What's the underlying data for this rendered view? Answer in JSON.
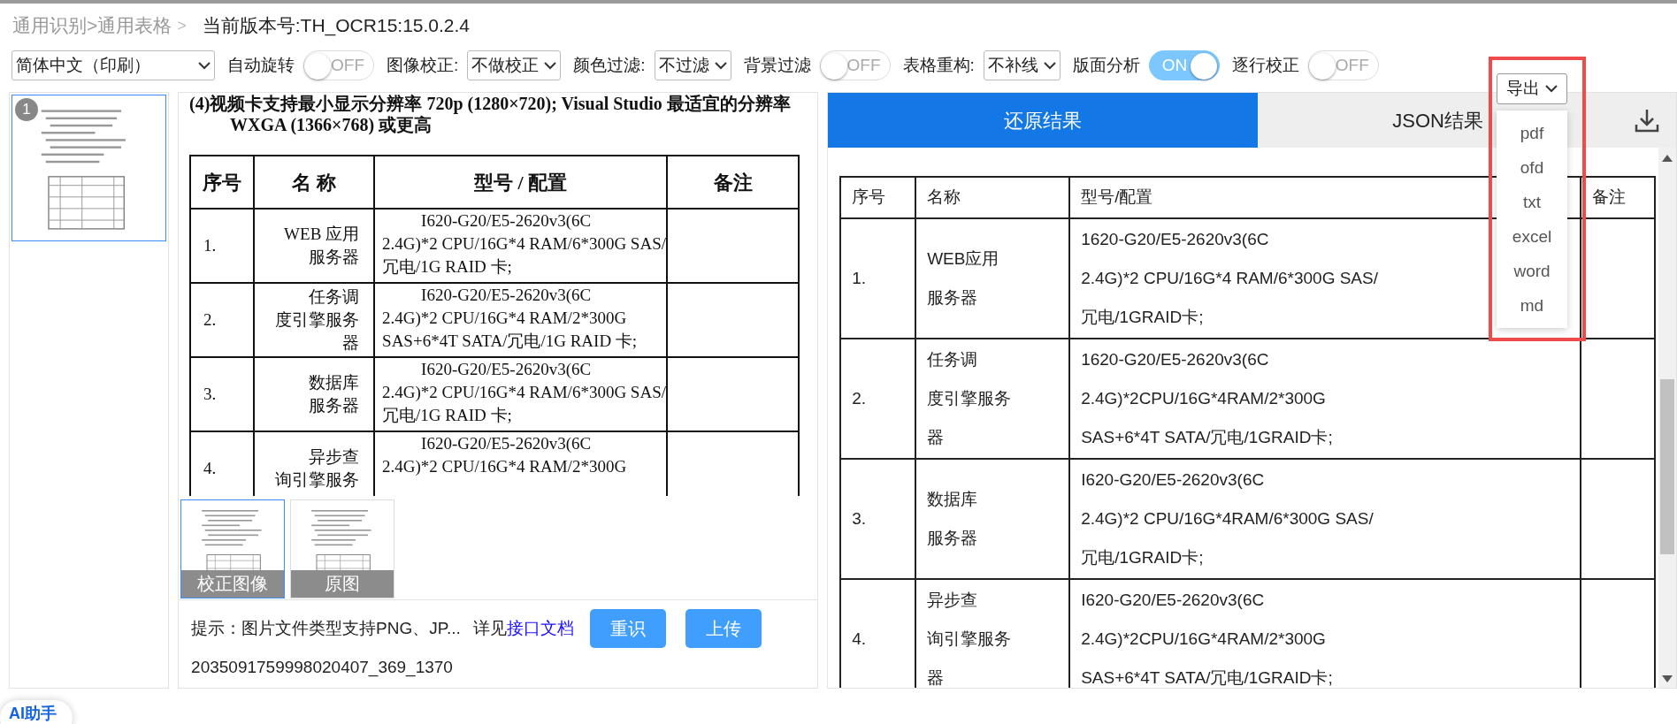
{
  "breadcrumb": {
    "path": "通用识别>通用表格",
    "separator": ">",
    "version": "当前版本号:TH_OCR15:15.0.2.4"
  },
  "toolbar": [
    {
      "kind": "select",
      "value": "简体中文（印刷）"
    },
    {
      "kind": "toggle",
      "label": "自动旋转",
      "on": false,
      "state_text": "OFF"
    },
    {
      "kind": "select",
      "label": "图像校正:",
      "value": "不做校正"
    },
    {
      "kind": "select",
      "label": "颜色过滤:",
      "value": "不过滤"
    },
    {
      "kind": "toggle",
      "label": "背景过滤",
      "on": false,
      "state_text": "OFF"
    },
    {
      "kind": "select",
      "label": "表格重构:",
      "value": "不补线"
    },
    {
      "kind": "toggle",
      "label": "版面分析",
      "on": true,
      "state_text": "ON"
    },
    {
      "kind": "toggle",
      "label": "逐行校正",
      "on": false,
      "state_text": "OFF"
    }
  ],
  "export": {
    "label": "导出",
    "expanded": true,
    "options": [
      "pdf",
      "ofd",
      "txt",
      "excel",
      "word",
      "md"
    ]
  },
  "pages": [
    {
      "number": "1",
      "selected": true
    }
  ],
  "document": {
    "intro": [
      "(4)视频卡支持最小显示分辨率 720p (1280×720); Visual Studio 最适宜的分辨率",
      "WXGA (1366×768) 或更高"
    ],
    "columns": [
      "序号",
      "名 称",
      "型号 / 配置",
      "备注"
    ],
    "rows": [
      {
        "no": "1.",
        "name": [
          "WEB 应用",
          "服务器"
        ],
        "config": [
          "I620-G20/E5-2620v3(6C",
          "2.4G)*2 CPU/16G*4 RAM/6*300G SAS/",
          "冗电/1G RAID 卡;"
        ]
      },
      {
        "no": "2.",
        "name": [
          "任务调",
          "度引擎服务",
          "器"
        ],
        "config": [
          "I620-G20/E5-2620v3(6C",
          "2.4G)*2 CPU/16G*4 RAM/2*300G",
          "SAS+6*4T SATA/冗电/1G RAID 卡;"
        ]
      },
      {
        "no": "3.",
        "name": [
          "数据库",
          "服务器"
        ],
        "config": [
          "I620-G20/E5-2620v3(6C",
          "2.4G)*2 CPU/16G*4 RAM/6*300G SAS/",
          "冗电/1G RAID 卡;"
        ]
      },
      {
        "no": "4.",
        "name": [
          "异步查",
          "询引擎服务"
        ],
        "config": [
          "I620-G20/E5-2620v3(6C",
          "2.4G)*2 CPU/16G*4 RAM/2*300G"
        ]
      }
    ]
  },
  "image_versions": [
    {
      "label": "校正图像",
      "selected": true
    },
    {
      "label": "原图",
      "selected": false
    }
  ],
  "hint": {
    "text": "提示：图片文件类型支持PNG、JP...",
    "see": "详见",
    "link": "接口文档"
  },
  "buttons": [
    "重识",
    "上传"
  ],
  "file_name": "2035091759998020407_369_1370",
  "result_tabs": [
    {
      "label": "还原结果",
      "selected": true
    },
    {
      "label": "JSON结果",
      "selected": false
    }
  ],
  "result_table": {
    "columns": [
      "序号",
      "名称",
      "型号/配置",
      "备注"
    ],
    "rows": [
      {
        "no": "1.",
        "name": [
          "WEB应用",
          "服务器"
        ],
        "config": [
          "1620-G20/E5-2620v3(6C",
          "2.4G)*2 CPU/16G*4 RAM/6*300G SAS/",
          "冗电/1GRAID卡;"
        ]
      },
      {
        "no": "2.",
        "name": [
          "任务调",
          "度引擎服务",
          "器"
        ],
        "config": [
          "1620-G20/E5-2620v3(6C",
          "2.4G)*2CPU/16G*4RAM/2*300G",
          "SAS+6*4T SATA/冗电/1GRAID卡;"
        ]
      },
      {
        "no": "3.",
        "name": [
          "数据库",
          "服务器"
        ],
        "config": [
          "I620-G20/E5-2620v3(6C",
          "2.4G)*2 CPU/16G*4RAM/6*300G SAS/",
          "冗电/1GRAID卡;"
        ]
      },
      {
        "no": "4.",
        "name": [
          "异步查",
          "询引擎服务",
          "器"
        ],
        "config": [
          "I620-G20/E5-2620v3(6C",
          "2.4G)*2CPU/16G*4RAM/2*300G",
          "SAS+6*4T SATA/冗电/1GRAID卡;"
        ]
      }
    ]
  },
  "assistant": {
    "label": "AI助手"
  }
}
